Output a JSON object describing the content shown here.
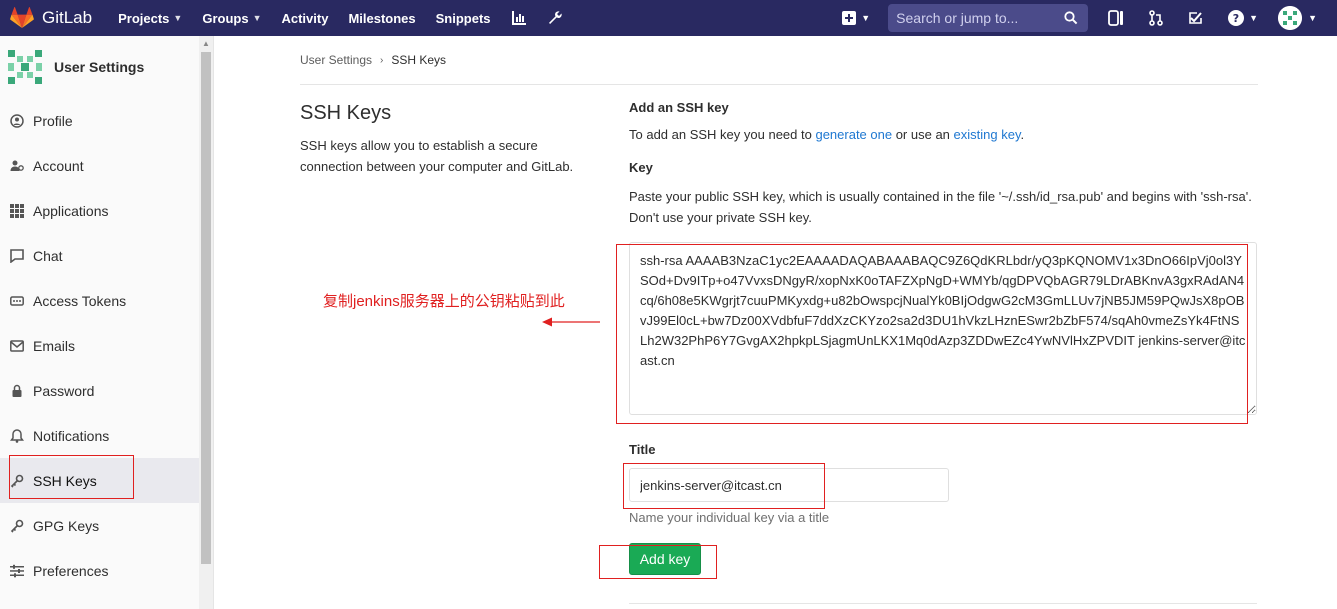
{
  "topbar": {
    "brand": "GitLab",
    "nav": [
      {
        "label": "Projects",
        "dropdown": true
      },
      {
        "label": "Groups",
        "dropdown": true
      },
      {
        "label": "Activity",
        "dropdown": false
      },
      {
        "label": "Milestones",
        "dropdown": false
      },
      {
        "label": "Snippets",
        "dropdown": false
      }
    ],
    "search_placeholder": "Search or jump to..."
  },
  "sidebar": {
    "title": "User Settings",
    "items": [
      {
        "label": "Profile",
        "icon": "profile-icon"
      },
      {
        "label": "Account",
        "icon": "account-icon"
      },
      {
        "label": "Applications",
        "icon": "applications-icon"
      },
      {
        "label": "Chat",
        "icon": "chat-icon"
      },
      {
        "label": "Access Tokens",
        "icon": "access-tokens-icon"
      },
      {
        "label": "Emails",
        "icon": "email-icon"
      },
      {
        "label": "Password",
        "icon": "lock-icon"
      },
      {
        "label": "Notifications",
        "icon": "bell-icon"
      },
      {
        "label": "SSH Keys",
        "icon": "key-icon",
        "active": true
      },
      {
        "label": "GPG Keys",
        "icon": "key-icon"
      },
      {
        "label": "Preferences",
        "icon": "preferences-icon"
      }
    ]
  },
  "breadcrumb": {
    "root": "User Settings",
    "current": "SSH Keys"
  },
  "intro": {
    "heading": "SSH Keys",
    "description": "SSH keys allow you to establish a secure connection between your computer and GitLab."
  },
  "form": {
    "heading": "Add an SSH key",
    "intro_before": "To add an SSH key you need to ",
    "link_generate": "generate one",
    "intro_middle": " or use an ",
    "link_existing": "existing key",
    "intro_after": ".",
    "key_label": "Key",
    "key_help": "Paste your public SSH key, which is usually contained in the file '~/.ssh/id_rsa.pub' and begins with 'ssh-rsa'. Don't use your private SSH key.",
    "key_value": "ssh-rsa AAAAB3NzaC1yc2EAAAADAQABAAABAQC9Z6QdKRLbdr/yQ3pKQNOMV1x3DnO66IpVj0ol3YSOd+Dv9ITp+o47VvxsDNgyR/xopNxK0oTAFZXpNgD+WMYb/qgDPVQbAGR79LDrABKnvA3gxRAdAN4cq/6h08e5KWgrjt7cuuPMKyxdg+u82bOwspcjNualYk0BIjOdgwG2cM3GmLLUv7jNB5JM59PQwJsX8pOBvJ99El0cL+bw7Dz00XVdbfuF7ddXzCKYzo2sa2d3DU1hVkzLHznESwr2bZbF574/sqAh0vmeZsYk4FtNSLh2W32PhP6Y7GvgAX2hpkpLSjagmUnLKX1Mq0dAzp3ZDDwEZc4YwNVlHxZPVDIT jenkins-server@itcast.cn",
    "title_label": "Title",
    "title_value": "jenkins-server@itcast.cn",
    "title_note": "Name your individual key via a title",
    "submit_label": "Add key"
  },
  "annotation": {
    "text": "复制jenkins服务器上的公钥粘贴到此",
    "color": "#e02020"
  },
  "colors": {
    "nav_bg": "#292961",
    "primary_button": "#1aaa55",
    "link": "#1f78d1"
  }
}
